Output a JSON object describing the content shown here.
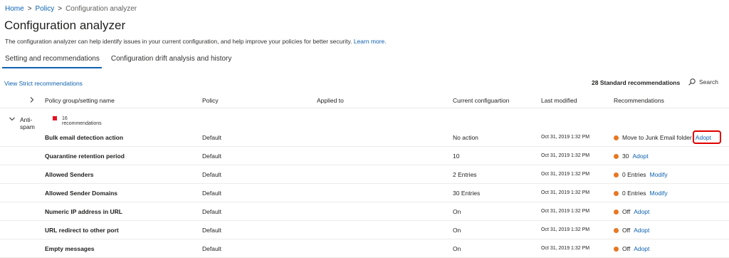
{
  "breadcrumb": {
    "home": "Home",
    "sep1": ">",
    "policy": "Policy",
    "sep2": ">",
    "current": "Configuration analyzer"
  },
  "page_title": "Configuration analyzer",
  "description": {
    "text": "The configuration analyzer can help identify issues in your current configuration, and help improve your policies for better security.",
    "learn_more": "Learn more."
  },
  "tabs": [
    {
      "label": "Setting and recommendations",
      "active": true
    },
    {
      "label": "Configuration drift analysis and history",
      "active": false
    }
  ],
  "toolbar": {
    "strict_link": "View Strict recommendations",
    "standard_count": "28 Standard recommendations",
    "search_label": "Search"
  },
  "columns": {
    "name": "Policy group/setting name",
    "policy": "Policy",
    "applied_to": "Applied to",
    "current": "Current configuartion",
    "modified": "Last modified",
    "recommendations": "Recommendations"
  },
  "group": {
    "name": "Anti-spam",
    "count": "16 recommendations",
    "color": "#e81123"
  },
  "rows": [
    {
      "name": "Bulk email detection action",
      "policy": "Default",
      "current": "No action",
      "modified": "Oct 31, 2019 1:32 PM",
      "rec": "Move to Junk Email folder",
      "action": "Adopt"
    },
    {
      "name": "Quarantine retention period",
      "policy": "Default",
      "current": "10",
      "modified": "Oct 31, 2019 1:32 PM",
      "rec": "30",
      "action": "Adopt"
    },
    {
      "name": "Allowed Senders",
      "policy": "Default",
      "current": "2 Entries",
      "modified": "Oct 31, 2019 1:32 PM",
      "rec": "0 Entries",
      "action": "Modify"
    },
    {
      "name": "Allowed Sender Domains",
      "policy": "Default",
      "current": "30 Entries",
      "modified": "Oct 31, 2019 1:32 PM",
      "rec": "0 Entries",
      "action": "Modify"
    },
    {
      "name": "Numeric IP address in URL",
      "policy": "Default",
      "current": "On",
      "modified": "Oct 31, 2019 1:32 PM",
      "rec": "Off",
      "action": "Adopt"
    },
    {
      "name": "URL redirect to other port",
      "policy": "Default",
      "current": "On",
      "modified": "Oct 31, 2019 1:32 PM",
      "rec": "Off",
      "action": "Adopt"
    },
    {
      "name": "Empty messages",
      "policy": "Default",
      "current": "On",
      "modified": "Oct 31, 2019 1:32 PM",
      "rec": "Off",
      "action": "Adopt"
    }
  ],
  "colors": {
    "accent": "#0f62b0",
    "warning_dot": "#e87722",
    "highlight": "#e00000"
  }
}
